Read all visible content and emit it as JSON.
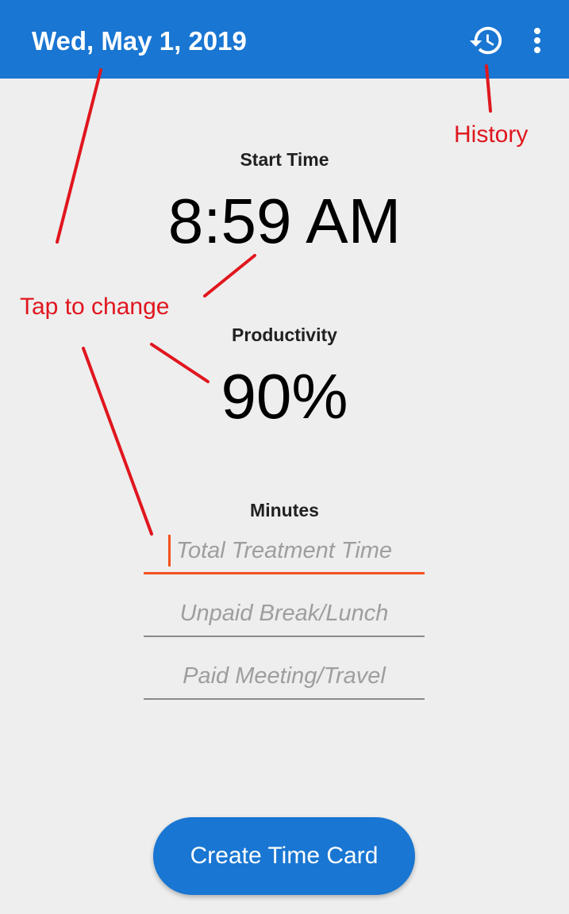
{
  "appbar": {
    "title": "Wed, May 1, 2019",
    "background_color": "#1976d2",
    "history_icon": "history-icon",
    "overflow_icon": "more-vert-icon"
  },
  "start_time": {
    "label": "Start Time",
    "value": "8:59 AM"
  },
  "productivity": {
    "label": "Productivity",
    "value": "90%"
  },
  "minutes": {
    "label": "Minutes",
    "fields": [
      {
        "placeholder": "Total Treatment Time",
        "focused": true
      },
      {
        "placeholder": "Unpaid Break/Lunch",
        "focused": false
      },
      {
        "placeholder": "Paid Meeting/Travel",
        "focused": false
      }
    ]
  },
  "create_button": {
    "label": "Create Time Card"
  },
  "annotations": {
    "history": "History",
    "tap_to_change": "Tap to change",
    "color": "#e0161e"
  },
  "accent_color": "#f4511e"
}
